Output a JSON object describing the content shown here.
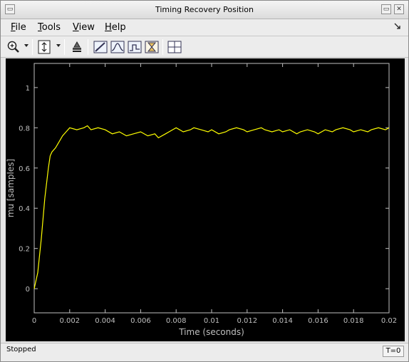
{
  "window": {
    "title": "Timing Recovery Position",
    "buttons": [
      "▭",
      "▭",
      "✕"
    ]
  },
  "menu": {
    "file": {
      "first": "F",
      "rest": "ile"
    },
    "tools": {
      "first": "T",
      "rest": "ools"
    },
    "view": {
      "first": "V",
      "rest": "iew"
    },
    "help": {
      "first": "H",
      "rest": "elp"
    },
    "dock_icon": "arrow-dock-icon"
  },
  "toolbar": {
    "icons": [
      "zoom-in-icon",
      "autoscale-icon",
      "restore-view-icon",
      "data-cursor-icon",
      "bilevel-measurements-icon",
      "signal-statistics-icon",
      "peak-finder-icon",
      "legend-grid-icon"
    ]
  },
  "status": {
    "text": "Stopped",
    "time": "T=0"
  },
  "chart_data": {
    "type": "line",
    "title": "",
    "xlabel": "Time (seconds)",
    "ylabel": "mu [samples]",
    "xlim": [
      0,
      0.02
    ],
    "ylim": [
      -0.12,
      1.12
    ],
    "xticks": [
      "0",
      "0.002",
      "0.004",
      "0.006",
      "0.008",
      "0.01",
      "0.012",
      "0.014",
      "0.016",
      "0.018",
      "0.02"
    ],
    "yticks": [
      "0",
      "0.2",
      "0.4",
      "0.6",
      "0.8",
      "1"
    ],
    "grid": false,
    "colors": {
      "background": "#000000",
      "axes": "#bfbfbf",
      "line": "#ffff00"
    },
    "series": [
      {
        "name": "",
        "x": [
          0,
          0.0002,
          0.0004,
          0.0006,
          0.0008,
          0.0009,
          0.001,
          0.0012,
          0.0014,
          0.0016,
          0.0018,
          0.002,
          0.0024,
          0.0028,
          0.003,
          0.0032,
          0.0036,
          0.004,
          0.0044,
          0.0048,
          0.0052,
          0.0056,
          0.006,
          0.0064,
          0.0068,
          0.007,
          0.0074,
          0.0078,
          0.008,
          0.0084,
          0.0088,
          0.009,
          0.0094,
          0.0098,
          0.01,
          0.0104,
          0.0108,
          0.011,
          0.0114,
          0.0118,
          0.012,
          0.0124,
          0.0128,
          0.013,
          0.0134,
          0.0138,
          0.014,
          0.0144,
          0.0148,
          0.015,
          0.0154,
          0.0158,
          0.016,
          0.0164,
          0.0168,
          0.017,
          0.0174,
          0.0178,
          0.018,
          0.0184,
          0.0188,
          0.019,
          0.0194,
          0.0198,
          0.02
        ],
        "y": [
          0.0,
          0.08,
          0.25,
          0.45,
          0.6,
          0.66,
          0.68,
          0.7,
          0.73,
          0.76,
          0.78,
          0.8,
          0.79,
          0.8,
          0.81,
          0.79,
          0.8,
          0.79,
          0.77,
          0.78,
          0.76,
          0.77,
          0.78,
          0.76,
          0.77,
          0.75,
          0.77,
          0.79,
          0.8,
          0.78,
          0.79,
          0.8,
          0.79,
          0.78,
          0.79,
          0.77,
          0.78,
          0.79,
          0.8,
          0.79,
          0.78,
          0.79,
          0.8,
          0.79,
          0.78,
          0.79,
          0.78,
          0.79,
          0.77,
          0.78,
          0.79,
          0.78,
          0.77,
          0.79,
          0.78,
          0.79,
          0.8,
          0.79,
          0.78,
          0.79,
          0.78,
          0.79,
          0.8,
          0.79,
          0.8
        ]
      }
    ]
  }
}
